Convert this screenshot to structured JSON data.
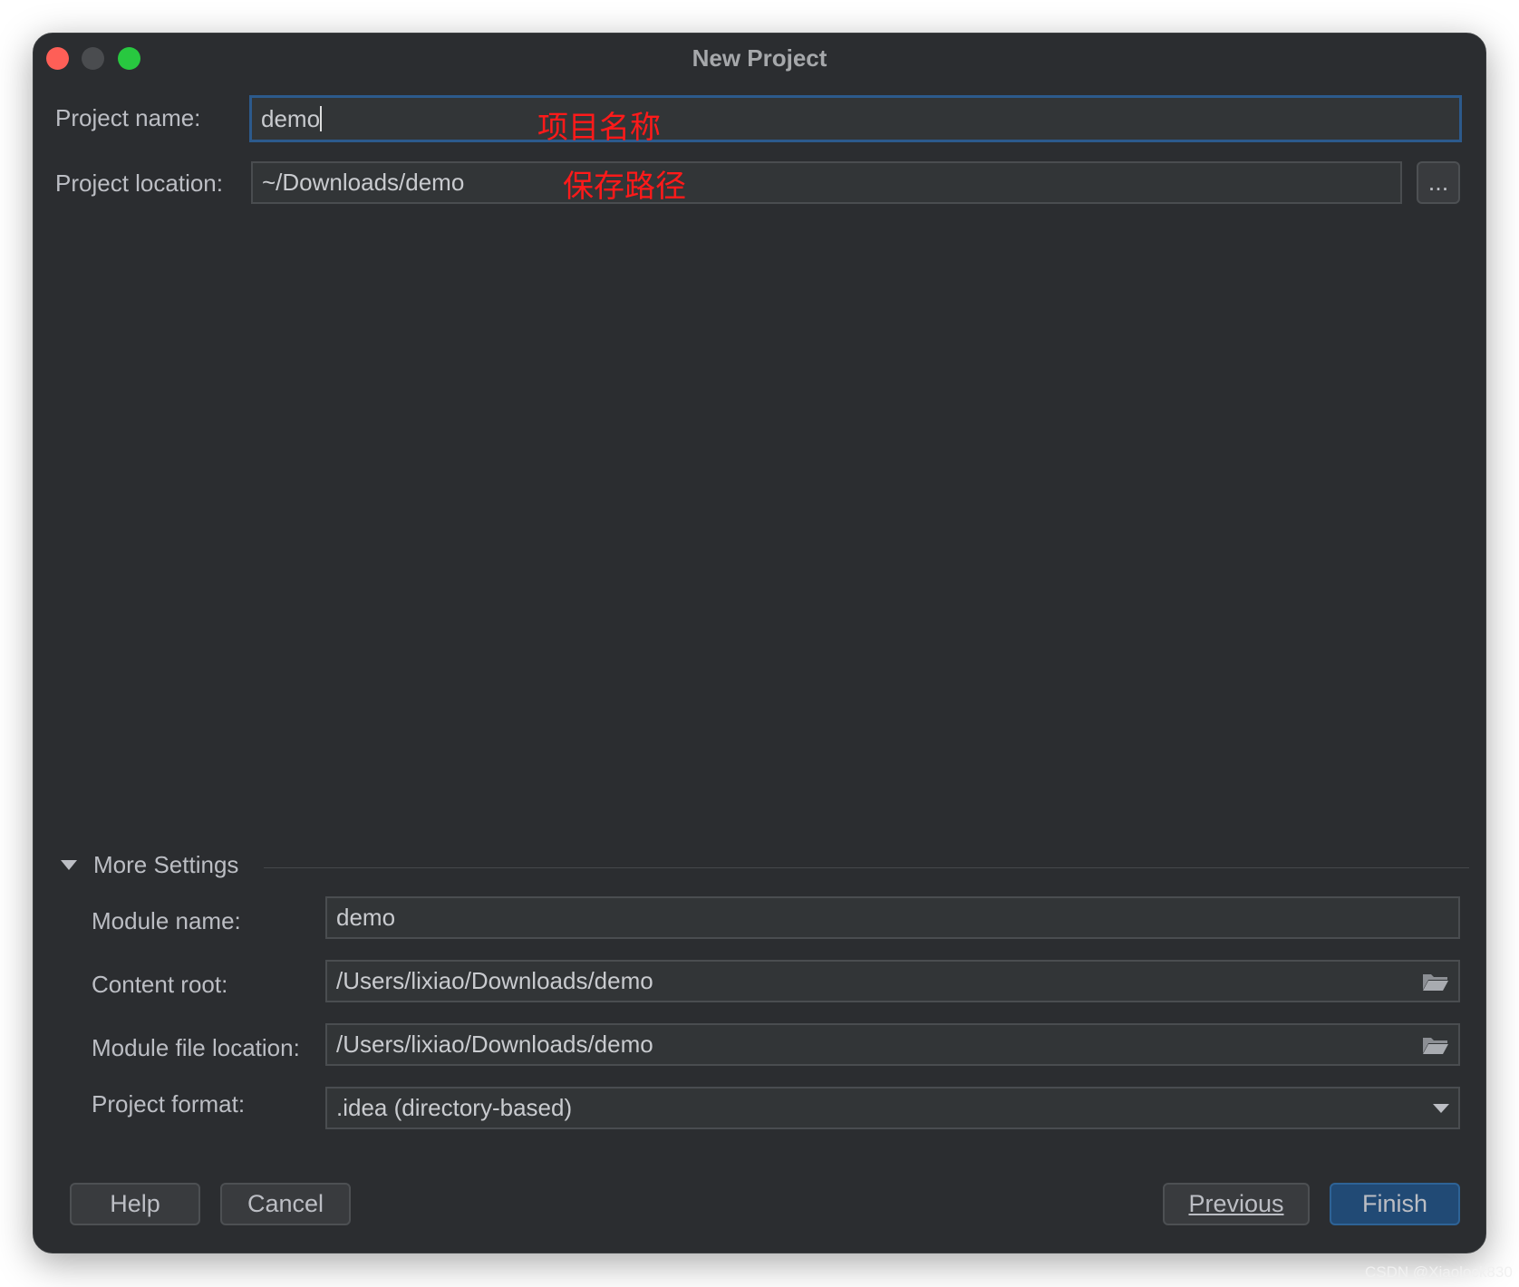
{
  "window": {
    "title": "New Project"
  },
  "project_name": {
    "label": "Project name:",
    "value": "demo",
    "annotation": "项目名称"
  },
  "project_location": {
    "label": "Project location:",
    "value": "~/Downloads/demo",
    "annotation": "保存路径",
    "browse_label": "..."
  },
  "more_settings": {
    "label": "More Settings",
    "expanded": true,
    "module_name": {
      "label": "Module name:",
      "value": "demo"
    },
    "content_root": {
      "label": "Content root:",
      "value": "/Users/lixiao/Downloads/demo"
    },
    "module_file_location": {
      "label": "Module file location:",
      "value": "/Users/lixiao/Downloads/demo"
    },
    "project_format": {
      "label": "Project format:",
      "value": ".idea (directory-based)"
    }
  },
  "buttons": {
    "help": "Help",
    "cancel": "Cancel",
    "previous": "Previous",
    "finish": "Finish"
  },
  "watermark": "CSDN @Xiaolock830",
  "colors": {
    "accent": "#214a75",
    "annotation": "#ff1a1a",
    "close": "#fe5f57",
    "zoom": "#28c840"
  }
}
